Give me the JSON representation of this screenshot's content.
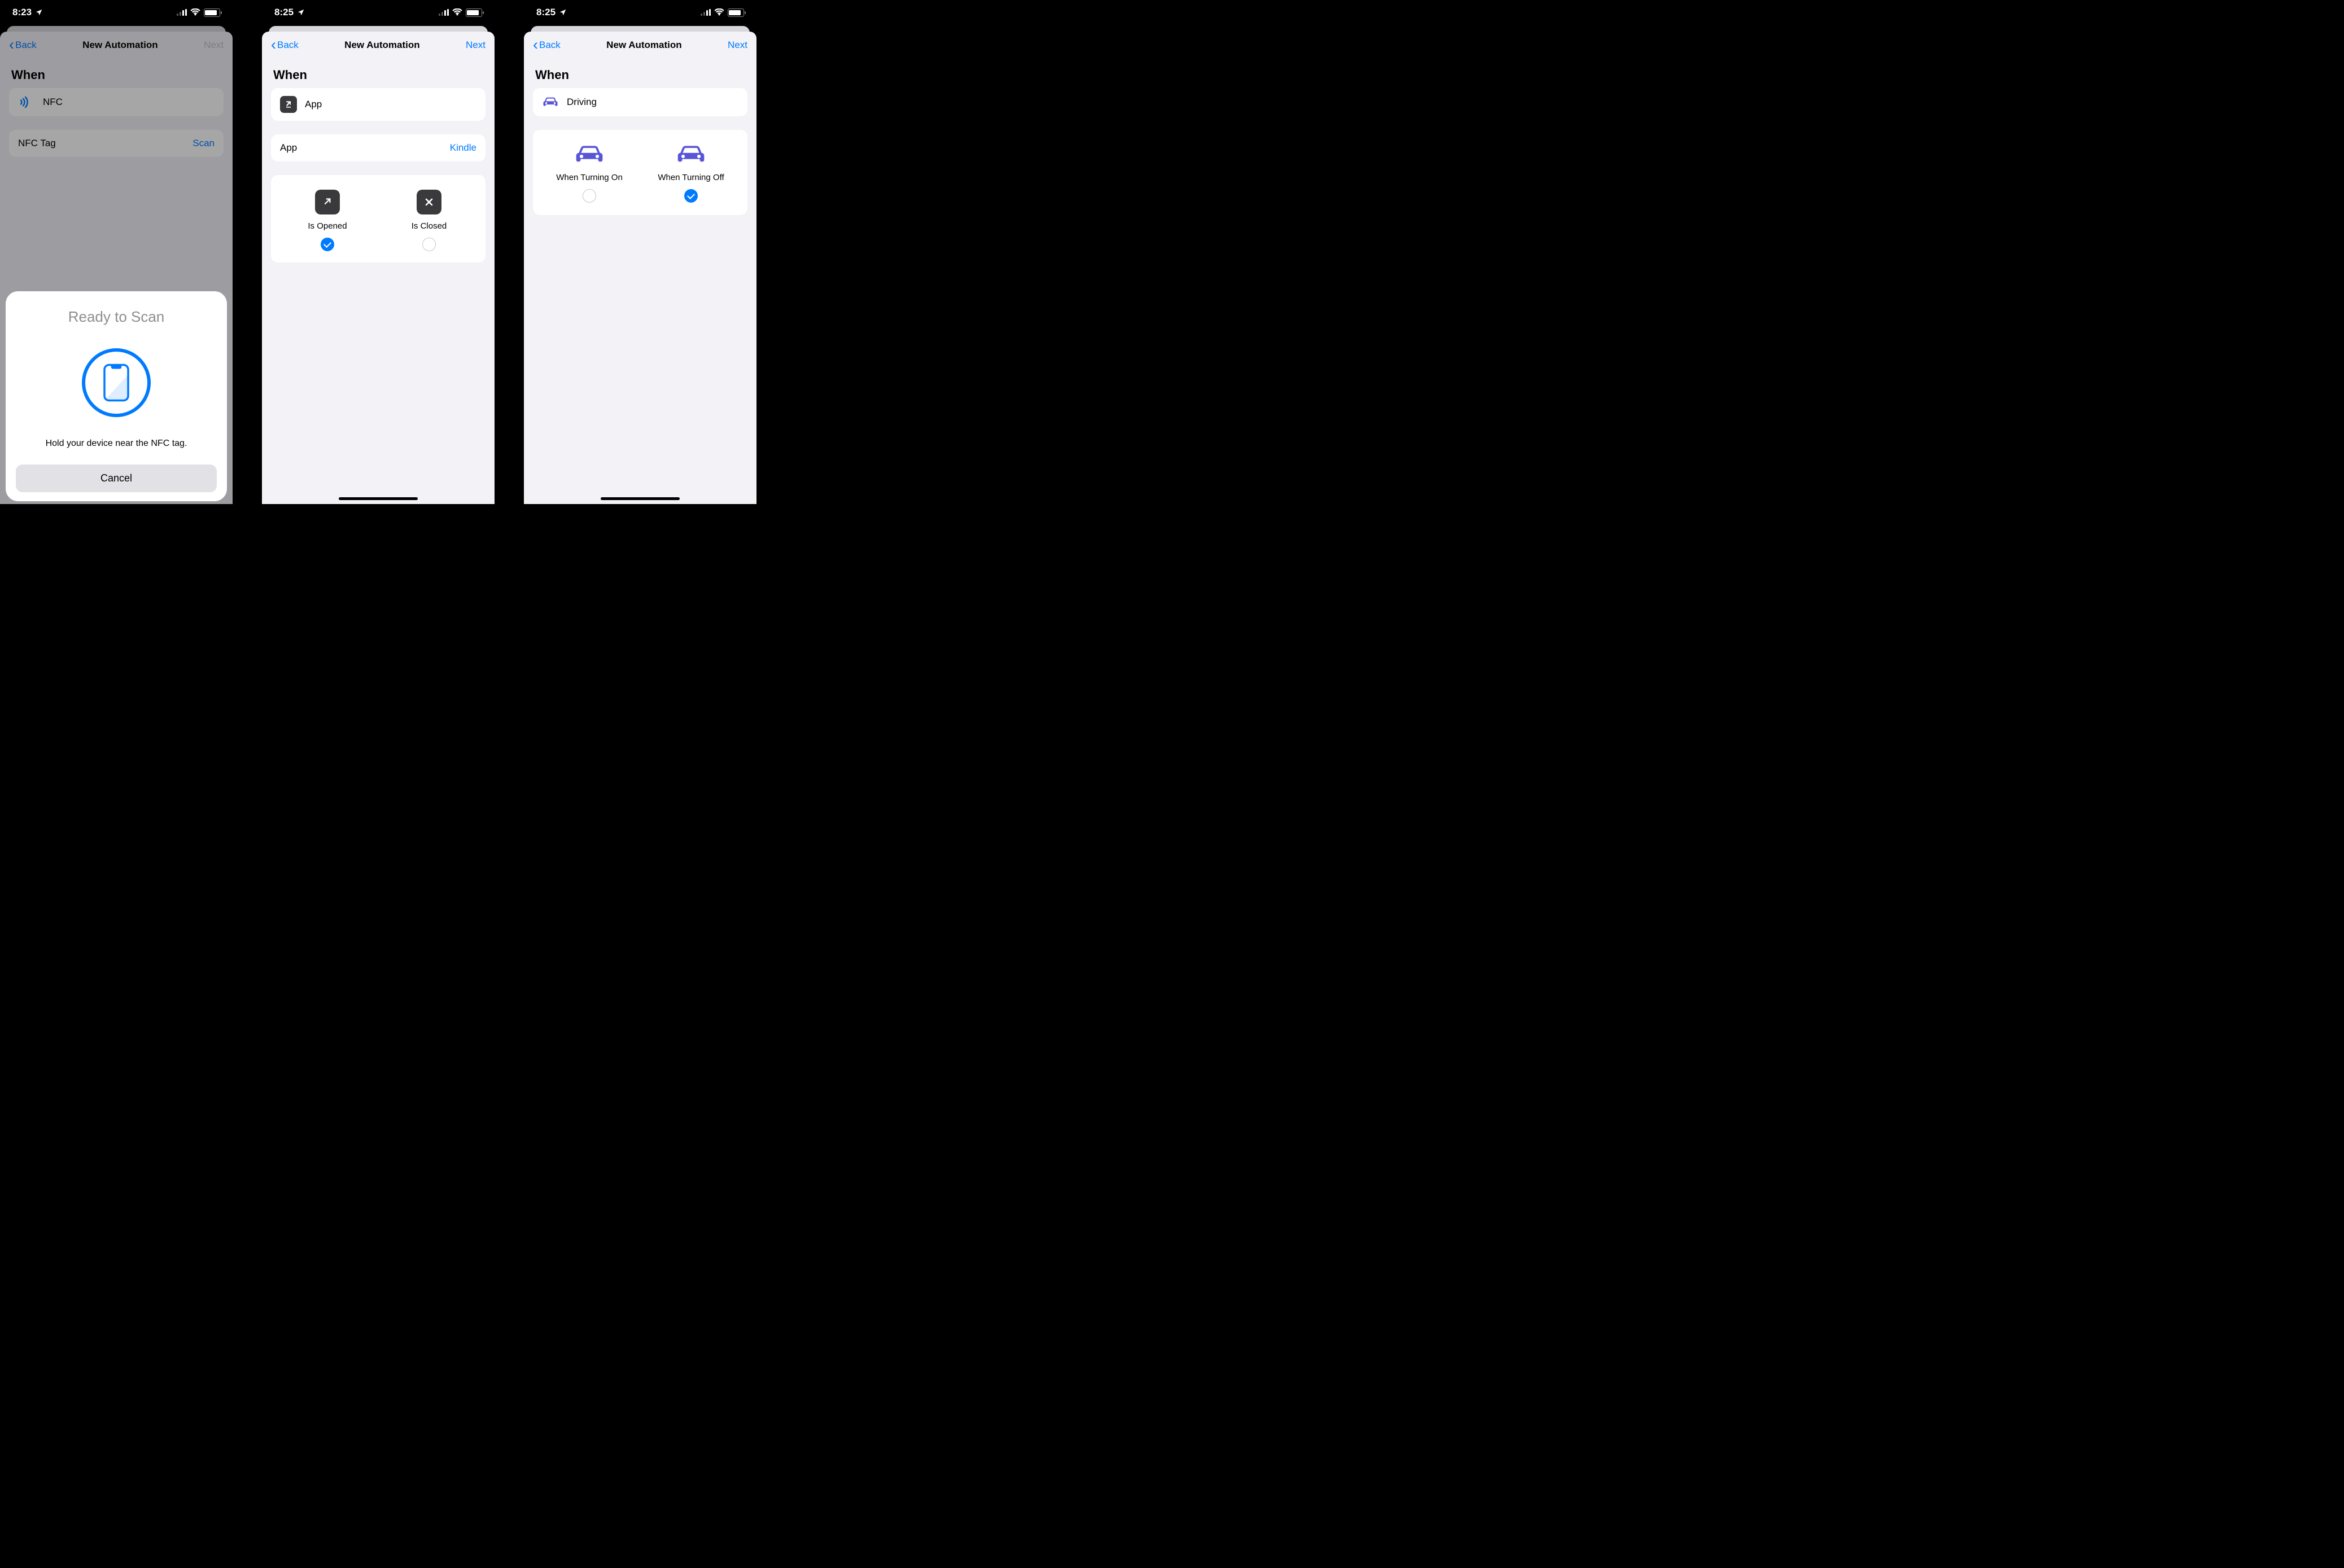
{
  "screens": {
    "nfc": {
      "status_time": "8:23",
      "nav_back": "Back",
      "nav_title": "New Automation",
      "nav_next": "Next",
      "section_when": "When",
      "trigger_label": "NFC",
      "tag_label": "NFC Tag",
      "tag_action": "Scan",
      "sheet_title": "Ready to Scan",
      "sheet_msg": "Hold your device near the NFC tag.",
      "sheet_cancel": "Cancel"
    },
    "app": {
      "status_time": "8:25",
      "nav_back": "Back",
      "nav_title": "New Automation",
      "nav_next": "Next",
      "section_when": "When",
      "trigger_label": "App",
      "selector_label": "App",
      "selector_value": "Kindle",
      "opt_opened": "Is Opened",
      "opt_closed": "Is Closed",
      "opened_selected": true,
      "closed_selected": false
    },
    "driving": {
      "status_time": "8:25",
      "nav_back": "Back",
      "nav_title": "New Automation",
      "nav_next": "Next",
      "section_when": "When",
      "trigger_label": "Driving",
      "opt_on": "When Turning On",
      "opt_off": "When Turning Off",
      "on_selected": false,
      "off_selected": true
    }
  },
  "colors": {
    "ios_blue": "#007aff",
    "ios_purple": "#5856d6"
  }
}
